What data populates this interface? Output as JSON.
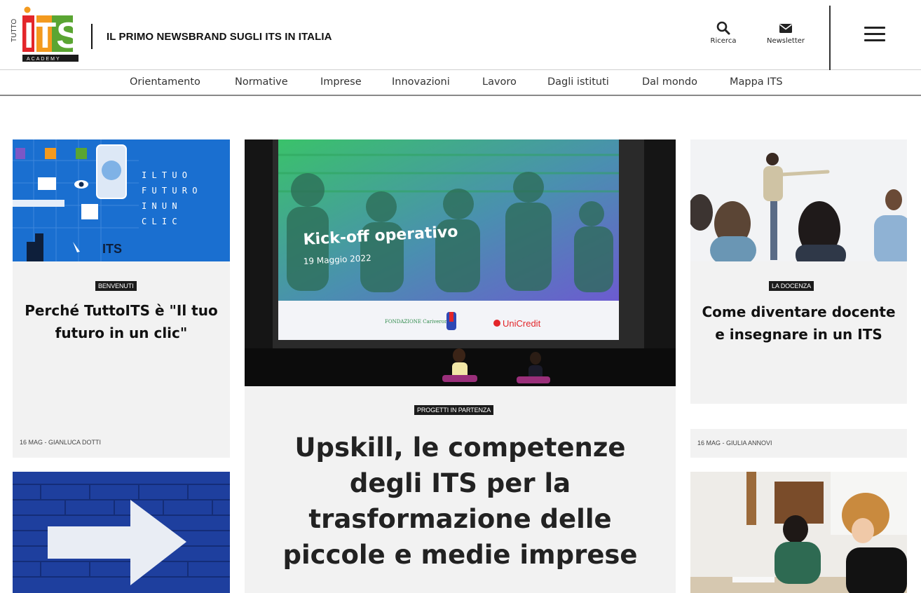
{
  "header": {
    "logo": {
      "vertical_text": "TUTTO",
      "letters": "ITS",
      "sub_text": "ACADEMY"
    },
    "tagline": "IL PRIMO NEWSBRAND SUGLI ITS IN ITALIA",
    "search_label": "Ricerca",
    "newsletter_label": "Newsletter",
    "icons": {
      "search": "search-icon",
      "newsletter": "envelope-icon",
      "menu": "hamburger-menu-icon"
    }
  },
  "nav": {
    "items": [
      "Orientamento",
      "Normative",
      "Imprese",
      "Innovazioni",
      "Lavoro",
      "Dagli istituti",
      "Dal mondo",
      "Mappa ITS"
    ]
  },
  "colors": {
    "logo_green": "#5aa532",
    "logo_red": "#e3262a",
    "logo_orange": "#f39a1e",
    "blue_tile": "#1a6fd0",
    "brick_blue": "#1e3f9e",
    "screen_green": "#3ac26a",
    "screen_purple": "#6c5bd0"
  },
  "cards": {
    "left_top": {
      "image_text": [
        "I L T U O",
        "F U T U R O",
        "I N U N",
        "C L I C"
      ],
      "image_logo": "ITS",
      "badge": "BENVENUTI",
      "title": "Perché TuttoITS è \"Il tuo futuro in un clic\"",
      "meta": "16 MAG - GIANLUCA DOTTI"
    },
    "center": {
      "screen_title": "Kick-off operativo",
      "screen_date": "19 Maggio 2022",
      "sponsors": [
        "FONDAZIONE Cariverona",
        "UniCredit"
      ],
      "badge": "PROGETTI IN PARTENZA",
      "title": "Upskill, le competenze degli ITS per la trasformazione delle piccole e medie imprese"
    },
    "right_top": {
      "badge": "LA DOCENZA",
      "title": "Come diventare docente e insegnare in un ITS",
      "meta": "16 MAG - GIULIA ANNOVI"
    }
  }
}
